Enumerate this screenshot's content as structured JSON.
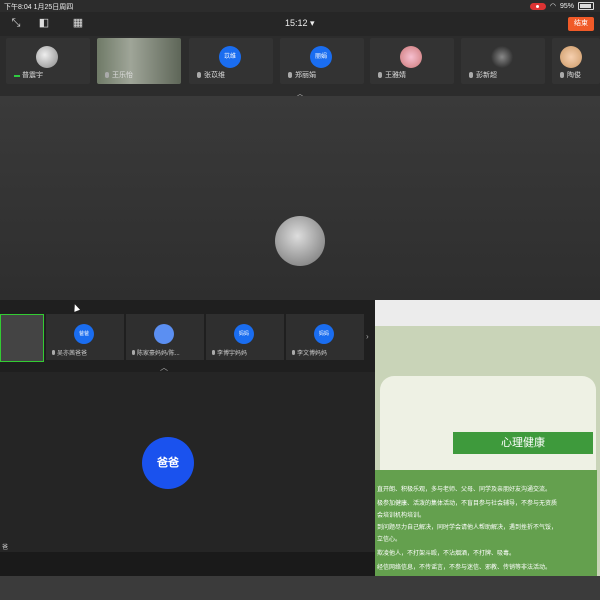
{
  "status": {
    "time_date": "下午8:04   1月25日周四",
    "battery": "95%"
  },
  "topbar": {
    "clock": "15:12 ▾",
    "end_label": "结束"
  },
  "tiles": [
    {
      "name": "普震宇",
      "type": "photo"
    },
    {
      "name": "王乐怡",
      "type": "video"
    },
    {
      "name": "张苡维",
      "type": "blue",
      "avatar": "苡维"
    },
    {
      "name": "郑丽娟",
      "type": "blue",
      "avatar": "丽娟"
    },
    {
      "name": "王雅婧",
      "type": "photo"
    },
    {
      "name": "彭新超",
      "type": "photo"
    },
    {
      "name": "陶俊",
      "type": "photo"
    }
  ],
  "inner": {
    "tiles": [
      {
        "name": "",
        "avatar": ""
      },
      {
        "name": "吴亦茜爸爸",
        "avatar": "爸爸"
      },
      {
        "name": "陈家豪妈妈/陈...",
        "avatar": ""
      },
      {
        "name": "李博宇妈妈",
        "avatar": "妈妈"
      },
      {
        "name": "李文博妈妈",
        "avatar": "妈妈"
      }
    ],
    "speaker_avatar": "爸爸",
    "bottom_tag": "爸"
  },
  "doc": {
    "title": "心理健康",
    "lines": [
      "直开朗、积极乐观，多与老师、父母、同学及亲朋好友沟通交流。",
      "极参加健康、活泼的集体活动，不盲目参与社会辅导，不参与无资质",
      "会培训机构培训。",
      "到问题尽力自己解决，同时学会请他人帮助解决，遇到挫折不气馁，",
      "立信心。",
      "欺凌他人，不打架斗殴，不沾烟酒，不打牌、吸毒。",
      "经信网络信息，不传谣言，不参与迷信、邪教、传销等非法活动。"
    ]
  }
}
